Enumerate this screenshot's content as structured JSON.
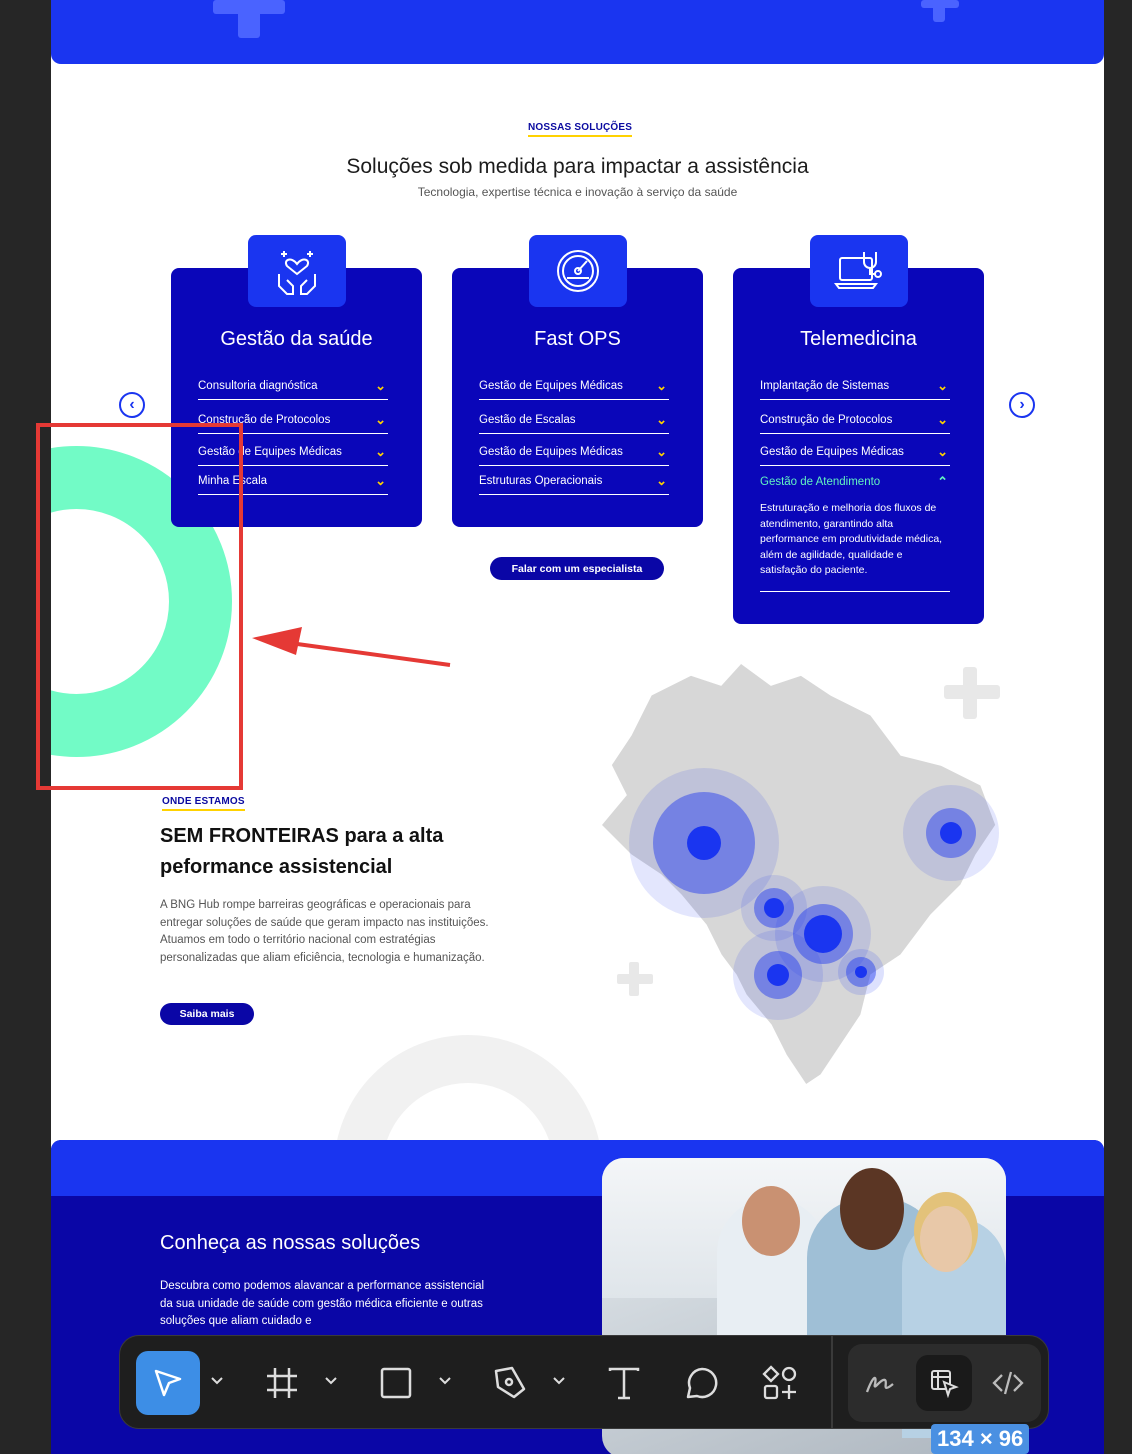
{
  "solutions": {
    "eyebrow": "NOSSAS SOLUÇÕES",
    "title": "Soluções sob medida para impactar a  assistência",
    "subtitle": "Tecnologia, expertise técnica e inovação à serviço da saúde",
    "cards": [
      {
        "title": "Gestão da saúde",
        "icon": "heart-hands-icon",
        "items": [
          "Consultoria diagnóstica",
          "Construção de Protocolos",
          "Gestão de Equipes Médicas",
          "Minha Escala"
        ]
      },
      {
        "title": "Fast OPS",
        "icon": "speedometer-icon",
        "items": [
          "Gestão de Equipes Médicas",
          "Gestão de Escalas",
          "Gestão de Equipes Médicas",
          "Estruturas Operacionais"
        ]
      },
      {
        "title": "Telemedicina",
        "icon": "laptop-stethoscope-icon",
        "items": [
          "Implantação de Sistemas",
          "Construção de Protocolos",
          "Gestão de Equipes Médicas",
          "Gestão de Atendimento"
        ],
        "active_item": 3,
        "description": "Estruturação e melhoria dos fluxos de atendimento, garantindo alta performance em produtividade médica, além de agilidade, qualidade e satisfação do paciente."
      }
    ],
    "cta": "Falar com um especialista",
    "prev_icon": "chevron-left-icon",
    "next_icon": "chevron-right-icon"
  },
  "location": {
    "eyebrow": "ONDE ESTAMOS",
    "title_line1": "SEM FRONTEIRAS para a alta",
    "title_line2": "peformance assistencial",
    "paragraph": "A BNG Hub rompe barreiras geográficas e operacionais para entregar soluções de saúde que geram impacto nas instituições. Atuamos em todo o território nacional com estratégias personalizadas que aliam eficiência, tecnologia e humanização.",
    "button": "Saiba mais"
  },
  "bottom": {
    "title": "Conheça as nossas soluções",
    "paragraph": "Descubra como podemos alavancar a performance assistencial da sua unidade de saúde com gestão médica eficiente e outras soluções que aliam cuidado e"
  },
  "toolbar": {
    "tools": [
      "move-tool",
      "frame-tool",
      "rectangle-tool",
      "pen-tool",
      "text-tool",
      "comment-tool",
      "assets-tool"
    ],
    "modes": [
      "draw-mode",
      "design-mode",
      "dev-mode"
    ]
  },
  "selection_size": "134 × 96",
  "colors": {
    "brand_blue": "#1a35f0",
    "dark_blue": "#0a06b9",
    "accent_yellow": "#ffd200",
    "mint": "#72fbc6",
    "annotation_red": "#e53935"
  }
}
